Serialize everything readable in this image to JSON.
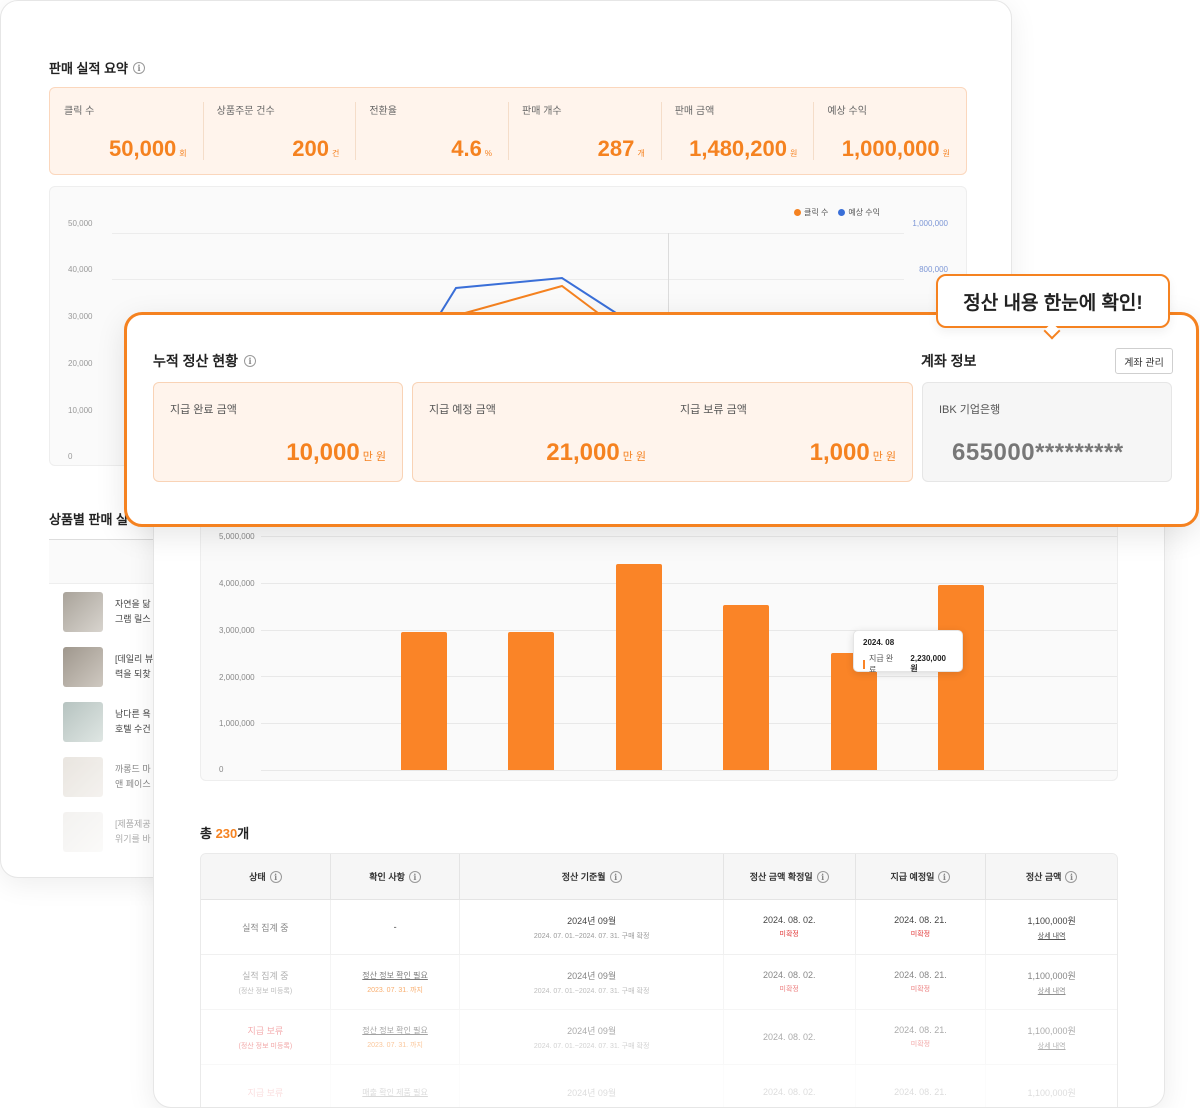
{
  "summary": {
    "title": "판매 실적 요약",
    "items": [
      {
        "label": "클릭 수",
        "value": "50,000",
        "unit": "회"
      },
      {
        "label": "상품주문 건수",
        "value": "200",
        "unit": "건"
      },
      {
        "label": "전환율",
        "value": "4.6",
        "unit": "%"
      },
      {
        "label": "판매 개수",
        "value": "287",
        "unit": "개"
      },
      {
        "label": "판매 금액",
        "value": "1,480,200",
        "unit": "원"
      },
      {
        "label": "예상 수익",
        "value": "1,000,000",
        "unit": "원"
      }
    ]
  },
  "line_chart": {
    "legend": [
      {
        "name": "클릭 수",
        "color": "#f58220"
      },
      {
        "name": "예상 수익",
        "color": "#3a6fd8"
      }
    ],
    "left_ticks": [
      "50,000",
      "40,000",
      "30,000",
      "20,000",
      "10,000",
      "0"
    ],
    "right_ticks": [
      "1,000,000",
      "800,000"
    ]
  },
  "products": {
    "title": "상품별 판매 실",
    "rows": [
      {
        "line1": "자연을 닮",
        "line2": "그램 릴스",
        "color": "#c9c4bb"
      },
      {
        "line1": "[데일리 뷰",
        "line2": "력을 되찾",
        "color": "#b9b3aa"
      },
      {
        "line1": "남다른 욕",
        "line2": "호텔 수건",
        "color": "#c8d2d0"
      },
      {
        "line1": "까롱드 마",
        "line2": "앤 페이스",
        "color": "#e6e2dc"
      },
      {
        "line1": "[제품제공",
        "line2": "위기를 바",
        "color": "#f0eeeb"
      }
    ]
  },
  "chart_data": {
    "type": "bar",
    "categories": [
      "",
      "",
      "",
      "",
      "",
      ""
    ],
    "values": [
      2950000,
      2950000,
      4400000,
      3520000,
      2500000,
      3950000
    ],
    "ylim": [
      0,
      5000000
    ],
    "yticks": [
      "5,000,000",
      "4,000,000",
      "3,000,000",
      "2,000,000",
      "1,000,000",
      "0"
    ],
    "grid": true,
    "tooltip": {
      "date": "2024. 08",
      "label": "지급 완료",
      "value": "2,230,000원"
    }
  },
  "total": {
    "prefix": "총 ",
    "count": "230",
    "suffix": "개"
  },
  "table": {
    "headers": [
      "상태",
      "확인 사항",
      "정산 기준월",
      "정산 금액 확정일",
      "지급 예정일",
      "정산 금액"
    ],
    "rows": [
      {
        "status": "실적 집계 중",
        "status_sub": "",
        "check": "-",
        "check_sub": "",
        "month": "2024년 09월",
        "period": "2024. 07. 01.~2024. 07. 31. 구매 확정",
        "confirm_date": "2024. 08. 02.",
        "confirm_sub": "미확정",
        "pay_date": "2024. 08. 21.",
        "pay_sub": "미확정",
        "amount": "1,100,000원",
        "detail": "상세 내역"
      },
      {
        "status": "실적 집계 중",
        "status_sub": "(정산 정보 미등록)",
        "check": "정산 정보 확인 필요",
        "check_sub": "2023. 07. 31. 까지",
        "month": "2024년 09월",
        "period": "2024. 07. 01.~2024. 07. 31. 구매 확정",
        "confirm_date": "2024. 08. 02.",
        "confirm_sub": "미확정",
        "pay_date": "2024. 08. 21.",
        "pay_sub": "미확정",
        "amount": "1,100,000원",
        "detail": "상세 내역"
      },
      {
        "status": "지급 보류",
        "status_sub": "(정산 정보 미등록)",
        "check": "정산 정보 확인 필요",
        "check_sub": "2023. 07. 31. 까지",
        "month": "2024년 09월",
        "period": "2024. 07. 01.~2024. 07. 31. 구매 확정",
        "confirm_date": "2024. 08. 02.",
        "confirm_sub": "",
        "pay_date": "2024. 08. 21.",
        "pay_sub": "미확정",
        "amount": "1,100,000원",
        "detail": "상세 내역"
      },
      {
        "status": "지급 보류",
        "status_sub": "",
        "check": "매출 확인 제품 필요",
        "check_sub": "",
        "month": "2024년 09월",
        "period": "",
        "confirm_date": "2024. 08. 02.",
        "confirm_sub": "",
        "pay_date": "2024. 08. 21.",
        "pay_sub": "",
        "amount": "1,100,000원",
        "detail": ""
      }
    ]
  },
  "settlement": {
    "title": "누적 정산 현황",
    "paid": {
      "label": "지급 완료 금액",
      "value": "10,000",
      "unit": "만 원"
    },
    "scheduled": {
      "label": "지급 예정 금액",
      "value": "21,000",
      "unit": "만 원"
    },
    "held": {
      "label": "지급 보류 금액",
      "value": "1,000",
      "unit": "만 원"
    }
  },
  "account": {
    "title": "계좌 정보",
    "manage_label": "계좌 관리",
    "bank": "IBK 기업은행",
    "number": "655000*********"
  },
  "callout": {
    "text": "정산 내용 한눈에 확인!"
  },
  "colors": {
    "accent": "#f58220",
    "bar": "#fa8427",
    "line_secondary": "#3a6fd8"
  }
}
